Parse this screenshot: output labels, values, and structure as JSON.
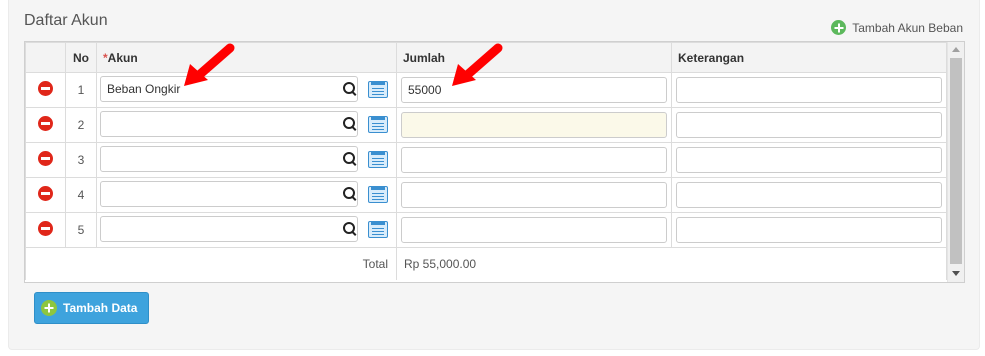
{
  "section": {
    "title": "Daftar Akun",
    "add_link_label": "Tambah Akun Beban"
  },
  "table": {
    "headers": {
      "no": "No",
      "akun_required": "*",
      "akun": "Akun",
      "jumlah": "Jumlah",
      "keterangan": "Keterangan"
    },
    "rows": [
      {
        "no": "1",
        "akun": "Beban Ongkir",
        "jumlah": "55000",
        "keterangan": ""
      },
      {
        "no": "2",
        "akun": "",
        "jumlah": "",
        "keterangan": ""
      },
      {
        "no": "3",
        "akun": "",
        "jumlah": "",
        "keterangan": ""
      },
      {
        "no": "4",
        "akun": "",
        "jumlah": "",
        "keterangan": ""
      },
      {
        "no": "5",
        "akun": "",
        "jumlah": "",
        "keterangan": ""
      }
    ],
    "total_label": "Total",
    "total_value": "Rp 55,000.00"
  },
  "buttons": {
    "add_data_label": "Tambah Data"
  },
  "icons": {
    "delete": "minus-circle-icon",
    "search": "search-icon",
    "list": "list-icon",
    "add": "plus-circle-icon",
    "annotation": "red-arrow-icon"
  },
  "colors": {
    "accent_blue": "#3ea3dd",
    "delete_red": "#e0271a",
    "add_green": "#5cb85c",
    "annotation_red": "#ff0000",
    "active_field_bg": "#fbf9e9"
  }
}
